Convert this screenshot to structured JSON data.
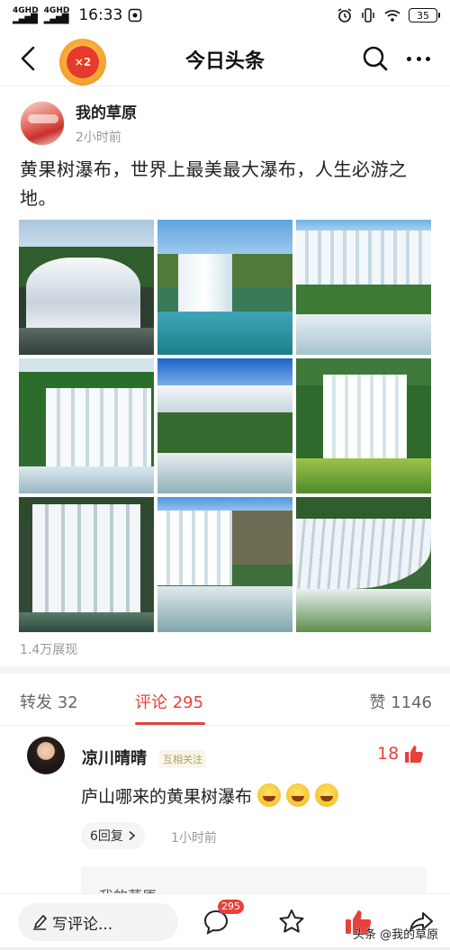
{
  "status_bar": {
    "network_1": "4G",
    "network_1_sub": "HD",
    "network_2": "4G",
    "network_2_sub": "HD",
    "time": "16:33",
    "battery": "35"
  },
  "nav": {
    "title": "今日头条",
    "coin_label": "×2"
  },
  "post": {
    "author": "我的草原",
    "time": "2小时前",
    "text": "黄果树瀑布，世界上最美最大瀑布，人生必游之地。",
    "views": "1.4万展现",
    "images": [
      {
        "name": "waterfall-image-1",
        "theme": "white-cascade"
      },
      {
        "name": "waterfall-image-2",
        "theme": "lake-cliff"
      },
      {
        "name": "waterfall-image-3",
        "theme": "wide-falls"
      },
      {
        "name": "waterfall-image-4",
        "theme": "green-falls"
      },
      {
        "name": "waterfall-image-5",
        "theme": "aerial-falls"
      },
      {
        "name": "waterfall-image-6",
        "theme": "jungle-falls"
      },
      {
        "name": "waterfall-image-7",
        "theme": "close-falls"
      },
      {
        "name": "waterfall-image-8",
        "theme": "rainbow-falls"
      },
      {
        "name": "waterfall-image-9",
        "theme": "curtain-falls"
      }
    ]
  },
  "tabs": {
    "forward": "转发 32",
    "comment": "评论 295",
    "like": "赞 1146"
  },
  "comment": {
    "user": "凉川晴晴",
    "follow_tag": "互相关注",
    "likes": "18",
    "text": "庐山哪来的黄果树瀑布",
    "reply_count": "6回复",
    "time": "1小时前",
    "sub_reply_preview": "我的草原"
  },
  "bottom_bar": {
    "write_placeholder": "写评论...",
    "comment_badge": "295",
    "watermark": "头条 @我的草原"
  },
  "colors": {
    "accent_red": "#e8413a",
    "text_primary": "#222222",
    "text_secondary": "#999999"
  },
  "icons": [
    "back-arrow-icon",
    "search-icon",
    "more-icon",
    "thumbs-up-icon",
    "chevron-right-icon",
    "pen-icon",
    "comment-icon",
    "star-icon",
    "share-icon",
    "wifi-icon",
    "alarm-icon",
    "vibrate-icon"
  ]
}
